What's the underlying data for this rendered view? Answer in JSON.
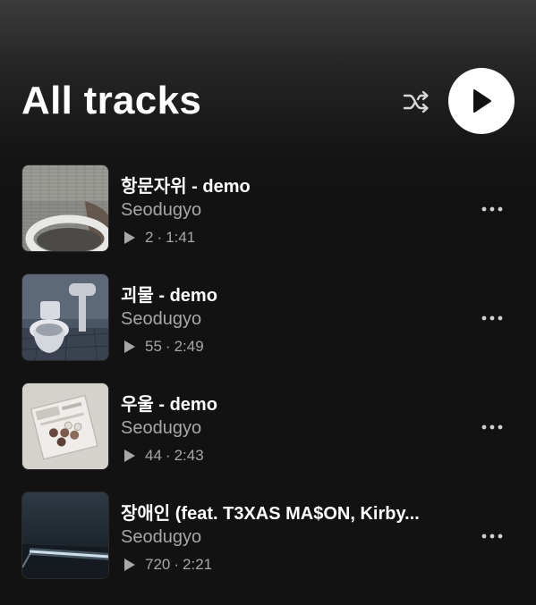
{
  "header": {
    "title": "All tracks",
    "shuffle_icon": "shuffle-icon",
    "play_icon": "play-icon"
  },
  "tracks": [
    {
      "title": "항문자위 - demo",
      "artist": "Seodugyo",
      "plays": "2",
      "separator": "·",
      "duration": "1:41",
      "cover": "tiled-wall-cover"
    },
    {
      "title": "괴물 - demo",
      "artist": "Seodugyo",
      "plays": "55",
      "separator": "·",
      "duration": "2:49",
      "cover": "toilet-cover"
    },
    {
      "title": "우울 - demo",
      "artist": "Seodugyo",
      "plays": "44",
      "separator": "·",
      "duration": "2:43",
      "cover": "pill-bag-cover"
    },
    {
      "title": "장애인 (feat. T3XAS MA$ON, Kirby...",
      "artist": "Seodugyo",
      "plays": "720",
      "separator": "·",
      "duration": "2:21",
      "cover": "dark-room-cover"
    }
  ],
  "colors": {
    "background": "#121212",
    "text_primary": "#ffffff",
    "text_secondary": "#a7a7a7"
  }
}
